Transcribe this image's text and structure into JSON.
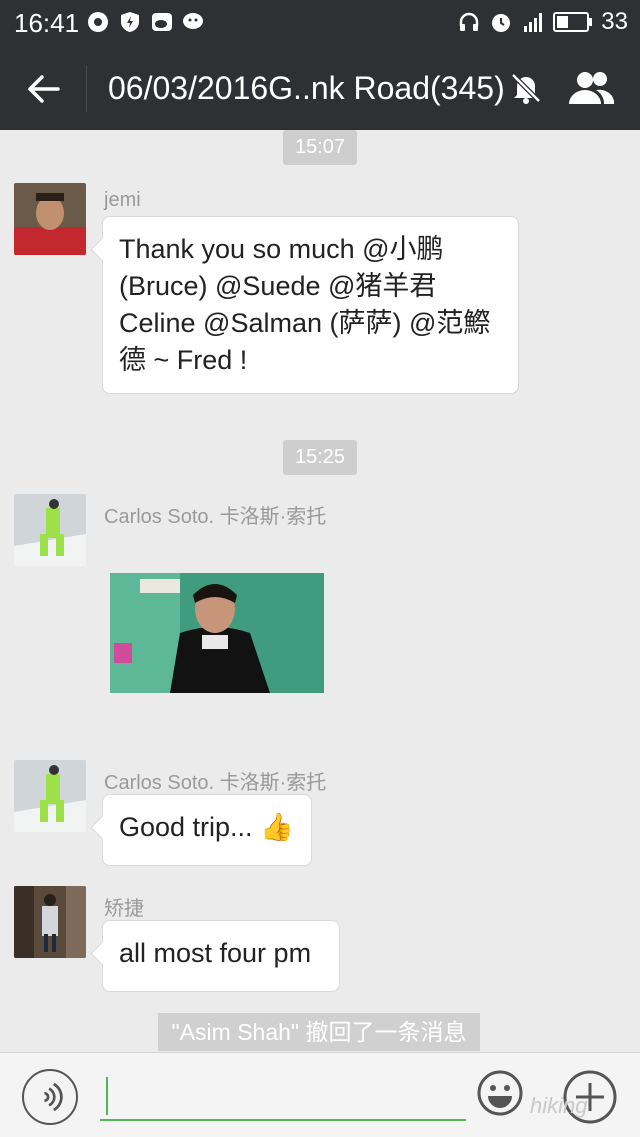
{
  "status": {
    "time": "16:41",
    "battery": "33"
  },
  "header": {
    "title": "06/03/2016G..nk Road(345)"
  },
  "messages": {
    "t1": "15:07",
    "m1": {
      "sender": "jemi",
      "lines": [
        "Thank you so much @小鹏",
        "(Bruce) @Suede @猪羊君",
        "Celine @Salman (萨萨) @范鰶",
        "德 ~ Fred !"
      ]
    },
    "t2": "15:25",
    "m2": {
      "sender": "Carlos Soto. 卡洛斯·索托"
    },
    "m3": {
      "sender": "Carlos Soto. 卡洛斯·索托",
      "text": "Good trip...",
      "emoji": "👍"
    },
    "m4": {
      "sender": "矫捷",
      "text": "all most four pm"
    },
    "recall": "\"Asim Shah\" 撤回了一条消息"
  },
  "input": {
    "placeholder": ""
  },
  "watermark": "hiking",
  "colors": {
    "bar": "#2f3033",
    "accent": "#53b457",
    "bg": "#ebebeb"
  }
}
